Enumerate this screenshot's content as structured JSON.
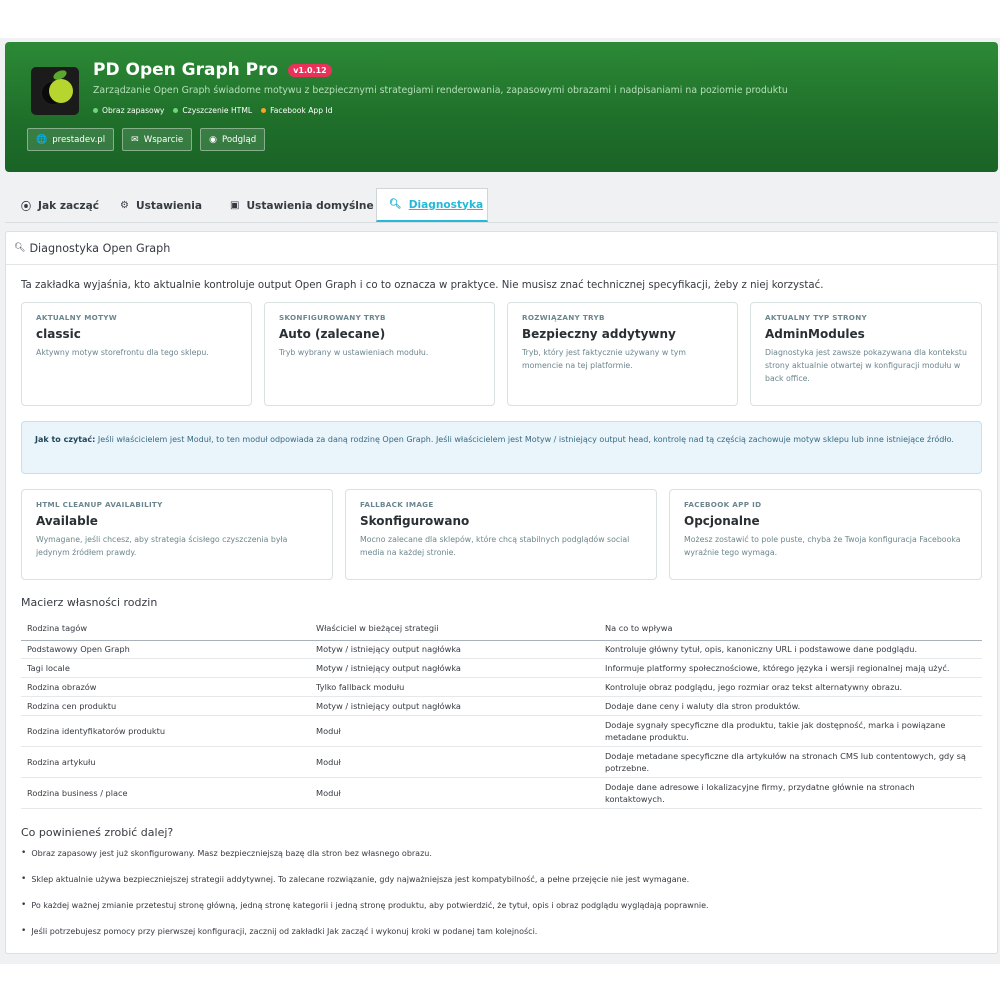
{
  "header": {
    "title": "PD Open Graph Pro",
    "version": "v1.0.12",
    "subtitle": "Zarządzanie Open Graph świadome motywu z bezpiecznymi strategiami renderowania, zapasowymi obrazami i nadpisaniami na poziomie produktu",
    "flags": [
      {
        "label": "Obraz zapasowy",
        "color": "#6fd47a"
      },
      {
        "label": "Czyszczenie HTML",
        "color": "#6fd47a"
      },
      {
        "label": "Facebook App Id",
        "color": "#f5a623"
      }
    ],
    "buttons": [
      {
        "label": "prestadev.pl",
        "icon": "globe-icon"
      },
      {
        "label": "Wsparcie",
        "icon": "envelope-icon"
      },
      {
        "label": "Podgląd",
        "icon": "eye-icon"
      }
    ]
  },
  "tabs": [
    {
      "label": "Jak zacząć",
      "icon": "compass-icon"
    },
    {
      "label": "Ustawienia",
      "icon": "gears-icon"
    },
    {
      "label": "Ustawienia domyślne",
      "icon": "image-icon"
    },
    {
      "label": "Diagnostyka",
      "icon": "search-icon",
      "active": true
    }
  ],
  "panel": {
    "title": "Diagnostyka Open Graph",
    "intro": "Ta zakładka wyjaśnia, kto aktualnie kontroluje output Open Graph i co to oznacza w praktyce. Nie musisz znać technicznej specyfikacji, żeby z niej korzystać.",
    "cards_top": [
      {
        "caption": "AKTUALNY MOTYW",
        "value": "classic",
        "desc": "Aktywny motyw storefrontu dla tego sklepu."
      },
      {
        "caption": "SKONFIGUROWANY TRYB",
        "value": "Auto (zalecane)",
        "desc": "Tryb wybrany w ustawieniach modułu."
      },
      {
        "caption": "ROZWIĄZANY TRYB",
        "value": "Bezpieczny addytywny",
        "desc": "Tryb, który jest faktycznie używany w tym momencie na tej platformie."
      },
      {
        "caption": "AKTUALNY TYP STRONY",
        "value": "AdminModules",
        "desc": "Diagnostyka jest zawsze pokazywana dla kontekstu strony aktualnie otwartej w konfiguracji modułu w back office."
      }
    ],
    "info_lead": "Jak to czytać:",
    "info_text": " Jeśli właścicielem jest Moduł, to ten moduł odpowiada za daną rodzinę Open Graph. Jeśli właścicielem jest Motyw / istniejący output head, kontrolę nad tą częścią zachowuje motyw sklepu lub inne istniejące źródło.",
    "cards_bottom": [
      {
        "caption": "HTML CLEANUP AVAILABILITY",
        "value": "Available",
        "desc": "Wymagane, jeśli chcesz, aby strategia ścisłego czyszczenia była jedynym źródłem prawdy."
      },
      {
        "caption": "FALLBACK IMAGE",
        "value": "Skonfigurowano",
        "desc": "Mocno zalecane dla sklepów, które chcą stabilnych podglądów social media na każdej stronie."
      },
      {
        "caption": "FACEBOOK APP ID",
        "value": "Opcjonalne",
        "desc": "Możesz zostawić to pole puste, chyba że Twoja konfiguracja Facebooka wyraźnie tego wymaga."
      }
    ],
    "matrix_title": "Macierz własności rodzin",
    "matrix_headers": [
      "Rodzina tagów",
      "Właściciel w bieżącej strategii",
      "Na co to wpływa"
    ],
    "matrix_rows": [
      [
        "Podstawowy Open Graph",
        "Motyw / istniejący output nagłówka",
        "Kontroluje główny tytuł, opis, kanoniczny URL i podstawowe dane podglądu."
      ],
      [
        "Tagi locale",
        "Motyw / istniejący output nagłówka",
        "Informuje platformy społecznościowe, którego języka i wersji regionalnej mają użyć."
      ],
      [
        "Rodzina obrazów",
        "Tylko fallback modułu",
        "Kontroluje obraz podglądu, jego rozmiar oraz tekst alternatywny obrazu."
      ],
      [
        "Rodzina cen produktu",
        "Motyw / istniejący output nagłówka",
        "Dodaje dane ceny i waluty dla stron produktów."
      ],
      [
        "Rodzina identyfikatorów produktu",
        "Moduł",
        "Dodaje sygnały specyficzne dla produktu, takie jak dostępność, marka i powiązane metadane produktu."
      ],
      [
        "Rodzina artykułu",
        "Moduł",
        "Dodaje metadane specyficzne dla artykułów na stronach CMS lub contentowych, gdy są potrzebne."
      ],
      [
        "Rodzina business / place",
        "Moduł",
        "Dodaje dane adresowe i lokalizacyjne firmy, przydatne głównie na stronach kontaktowych."
      ]
    ],
    "next_title": "Co powinieneś zrobić dalej?",
    "next_items": [
      "Obraz zapasowy jest już skonfigurowany. Masz bezpieczniejszą bazę dla stron bez własnego obrazu.",
      "Sklep aktualnie używa bezpieczniejszej strategii addytywnej. To zalecane rozwiązanie, gdy najważniejsza jest kompatybilność, a pełne przejęcie nie jest wymagane.",
      "Po każdej ważnej zmianie przetestuj stronę główną, jedną stronę kategorii i jedną stronę produktu, aby potwierdzić, że tytuł, opis i obraz podglądu wyglądają poprawnie.",
      "Jeśli potrzebujesz pomocy przy pierwszej konfiguracji, zacznij od zakładki Jak zacząć i wykonuj kroki w podanej tam kolejności."
    ]
  }
}
